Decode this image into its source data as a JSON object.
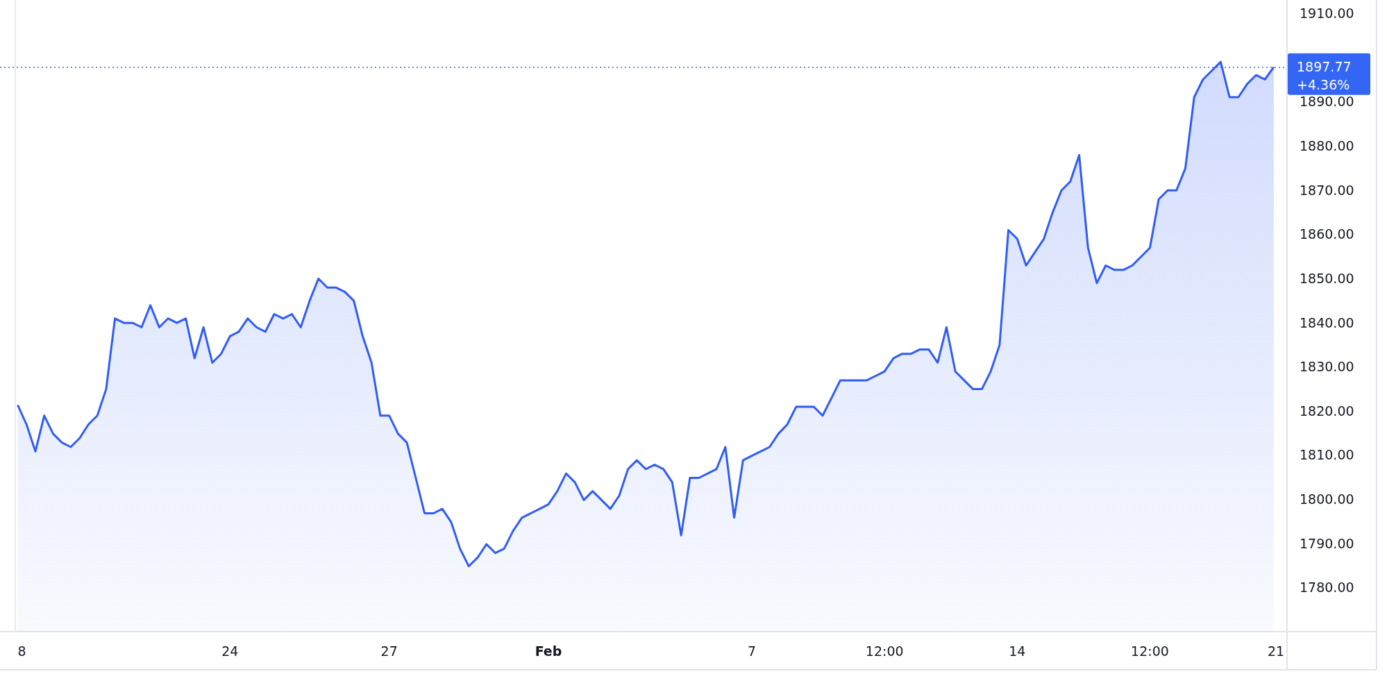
{
  "chart_data": {
    "type": "area",
    "ylim": [
      1770,
      1913
    ],
    "ref_lines": [
      {
        "axis": "y",
        "value": 1897.77,
        "color": "#3366f5"
      }
    ],
    "categories": [
      "8",
      null,
      null,
      null,
      null,
      null,
      null,
      null,
      null,
      null,
      null,
      null,
      null,
      null,
      null,
      null,
      null,
      null,
      null,
      null,
      null,
      null,
      null,
      null,
      "24",
      null,
      null,
      null,
      null,
      null,
      null,
      null,
      null,
      null,
      null,
      null,
      null,
      null,
      null,
      null,
      null,
      null,
      "27",
      null,
      null,
      null,
      null,
      null,
      null,
      null,
      null,
      null,
      null,
      null,
      null,
      null,
      null,
      null,
      null,
      null,
      "**Feb**",
      null,
      null,
      null,
      null,
      null,
      null,
      null,
      null,
      null,
      null,
      null,
      null,
      null,
      null,
      null,
      null,
      null,
      null,
      null,
      null,
      null,
      null,
      "7",
      null,
      null,
      null,
      null,
      null,
      null,
      null,
      null,
      null,
      null,
      null,
      null,
      null,
      null,
      "12:00",
      null,
      null,
      null,
      null,
      null,
      null,
      null,
      null,
      null,
      null,
      null,
      null,
      null,
      null,
      "14",
      null,
      null,
      null,
      null,
      null,
      null,
      null,
      null,
      null,
      null,
      null,
      null,
      null,
      null,
      "12:00",
      null,
      null,
      null,
      null,
      null,
      null,
      null,
      null,
      null,
      null,
      null,
      null,
      null,
      null,
      "21"
    ],
    "yticks": [
      {
        "value": 1780,
        "label": "1780.00"
      },
      {
        "value": 1790,
        "label": "1790.00"
      },
      {
        "value": 1800,
        "label": "1800.00"
      },
      {
        "value": 1810,
        "label": "1810.00"
      },
      {
        "value": 1820,
        "label": "1820.00"
      },
      {
        "value": 1830,
        "label": "1830.00"
      },
      {
        "value": 1840,
        "label": "1840.00"
      },
      {
        "value": 1850,
        "label": "1850.00"
      },
      {
        "value": 1860,
        "label": "1860.00"
      },
      {
        "value": 1870,
        "label": "1870.00"
      },
      {
        "value": 1880,
        "label": "1880.00"
      },
      {
        "value": 1890,
        "label": "1890.00"
      },
      {
        "value": 1910,
        "label": "1910.00"
      }
    ],
    "series": [
      {
        "color": "#2f5cf5",
        "values": [
          1821.3,
          1816.9,
          1810.8,
          1818.9,
          1814.8,
          1812.8,
          1811.8,
          1813.8,
          1816.9,
          1818.9,
          1824.9,
          1840.9,
          1839.9,
          1839.9,
          1838.9,
          1843.9,
          1838.9,
          1840.9,
          1839.9,
          1840.9,
          1831.9,
          1838.9,
          1830.9,
          1832.9,
          1836.9,
          1837.9,
          1840.9,
          1838.9,
          1837.9,
          1841.9,
          1840.9,
          1841.9,
          1838.9,
          1844.9,
          1849.9,
          1847.9,
          1847.9,
          1846.9,
          1844.9,
          1836.9,
          1830.9,
          1818.9,
          1818.9,
          1814.8,
          1812.8,
          1804.8,
          1796.8,
          1796.8,
          1797.8,
          1794.8,
          1788.8,
          1784.8,
          1786.8,
          1789.8,
          1787.8,
          1788.8,
          1792.8,
          1795.8,
          1796.8,
          1797.8,
          1798.8,
          1801.8,
          1805.8,
          1803.8,
          1799.8,
          1801.8,
          1799.8,
          1797.8,
          1800.8,
          1806.8,
          1808.8,
          1806.8,
          1807.8,
          1806.8,
          1803.8,
          1791.8,
          1804.8,
          1804.8,
          1805.8,
          1806.8,
          1811.8,
          1795.8,
          1808.8,
          1809.8,
          1810.8,
          1811.8,
          1814.8,
          1816.9,
          1820.9,
          1820.9,
          1820.9,
          1818.9,
          1822.9,
          1826.9,
          1826.9,
          1826.9,
          1826.9,
          1827.9,
          1828.9,
          1831.9,
          1832.9,
          1832.9,
          1833.9,
          1833.9,
          1830.9,
          1838.9,
          1828.9,
          1826.9,
          1824.9,
          1824.9,
          1828.9,
          1834.9,
          1860.9,
          1858.9,
          1852.9,
          1855.9,
          1858.9,
          1864.9,
          1869.9,
          1871.9,
          1877.9,
          1856.9,
          1848.9,
          1852.9,
          1851.9,
          1851.9,
          1852.9,
          1854.9,
          1856.9,
          1867.9,
          1869.9,
          1869.9,
          1874.9,
          1891.0,
          1895.0,
          1897.0,
          1899.0,
          1891.0,
          1891.0,
          1894.0,
          1896.0,
          1895.0,
          1897.8,
          null
        ]
      }
    ]
  },
  "last_price": {
    "value": "1897.77",
    "change": "+4.36%",
    "color": "#3366f5"
  }
}
